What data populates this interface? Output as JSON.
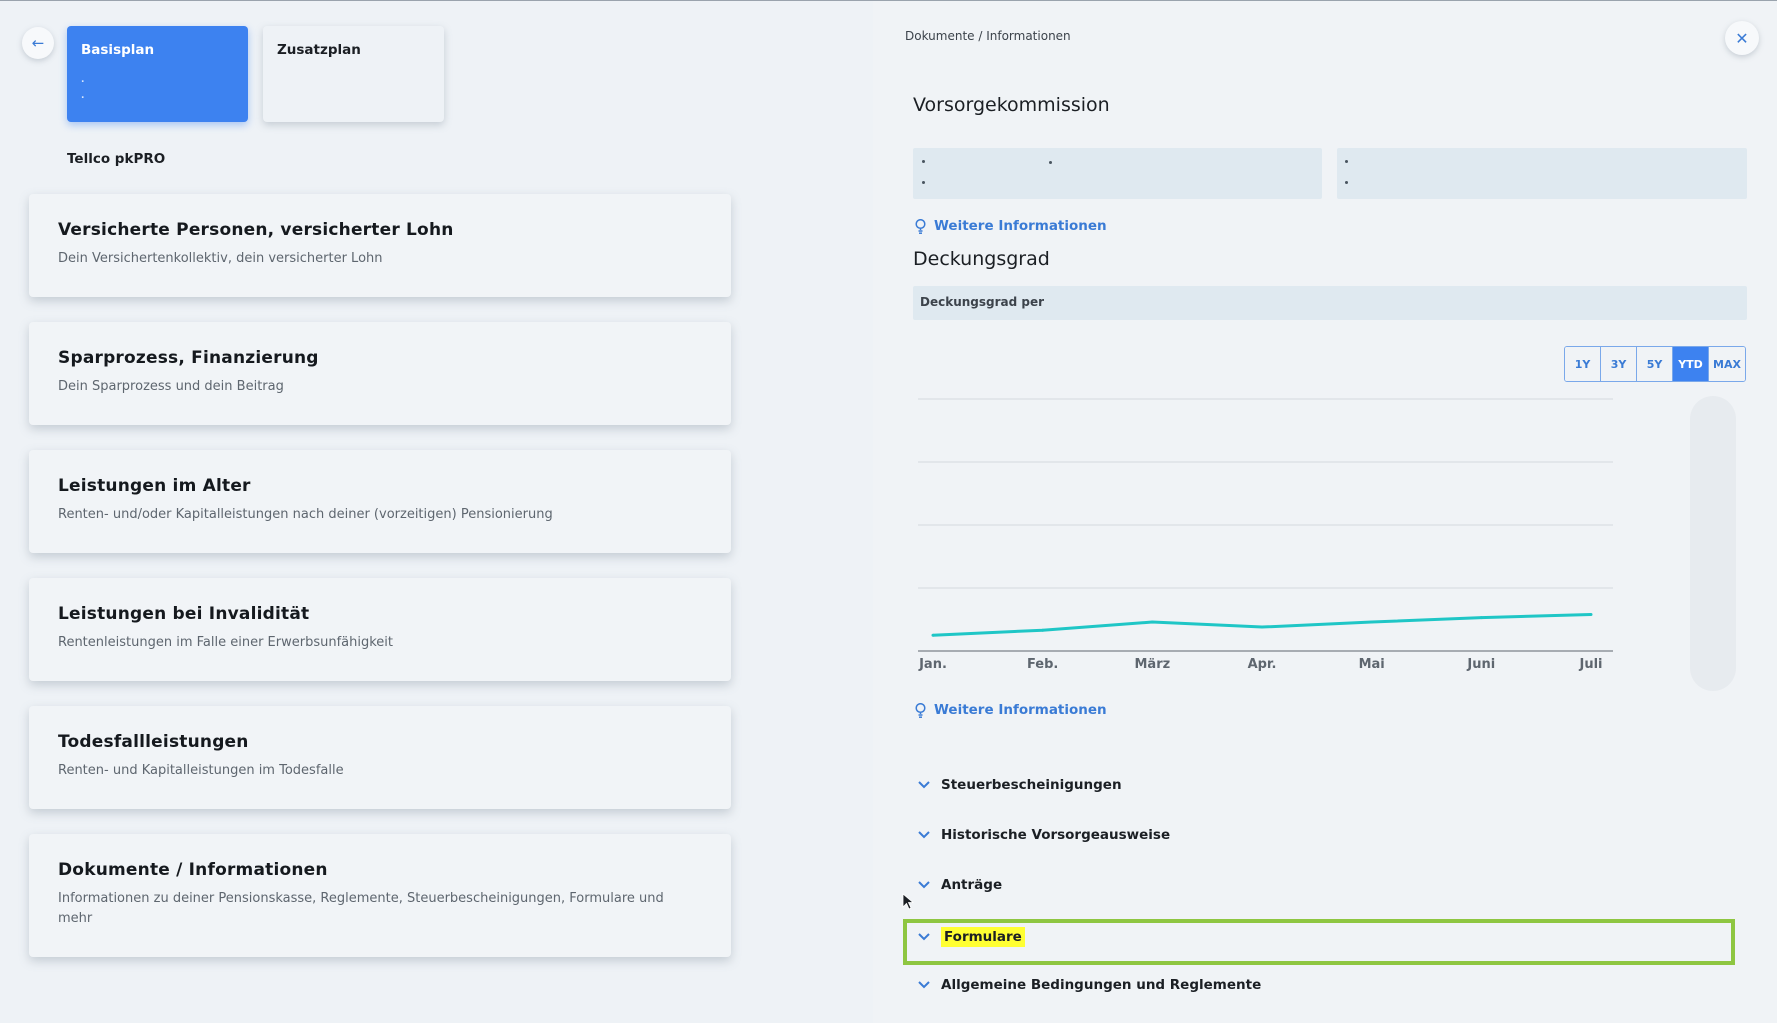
{
  "left": {
    "back_icon": "arrow-left-icon",
    "plans": [
      {
        "label": "Basisplan",
        "active": true
      },
      {
        "label": "Zusatzplan",
        "active": false
      }
    ],
    "provider": "Tellco pkPRO",
    "cards": [
      {
        "title": "Versicherte Personen, versicherter Lohn",
        "subtitle": "Dein Versichertenkollektiv, dein versicherter Lohn"
      },
      {
        "title": "Sparprozess, Finanzierung",
        "subtitle": "Dein Sparprozess und dein Beitrag"
      },
      {
        "title": "Leistungen im Alter",
        "subtitle": "Renten- und/oder Kapitalleistungen nach deiner (vorzeitigen) Pensionierung"
      },
      {
        "title": "Leistungen bei Invalidität",
        "subtitle": "Rentenleistungen im Falle einer Erwerbsunfähigkeit"
      },
      {
        "title": "Todesfallleistungen",
        "subtitle": "Renten- und Kapitalleistungen im Todesfalle"
      },
      {
        "title": "Dokumente / Informationen",
        "subtitle": "Informationen zu deiner Pensionskasse, Reglemente, Steuerbescheinigungen, Formulare und mehr"
      }
    ]
  },
  "right": {
    "breadcrumb": "Dokumente / Informationen",
    "close_icon": "close-icon",
    "vorsorge_title": "Vorsorgekommission",
    "more_info_label": "Weitere Informationen",
    "deckungsgrad_title": "Deckungsgrad",
    "deckungsgrad_per": "Deckungsgrad per",
    "ranges": [
      {
        "label": "1Y",
        "active": false
      },
      {
        "label": "3Y",
        "active": false
      },
      {
        "label": "5Y",
        "active": false
      },
      {
        "label": "YTD",
        "active": true
      },
      {
        "label": "MAX",
        "active": false
      }
    ],
    "accordion": [
      {
        "label": "Steuerbescheinigungen",
        "highlighted": false
      },
      {
        "label": "Historische Vorsorgeausweise",
        "highlighted": false
      },
      {
        "label": "Anträge",
        "highlighted": false
      },
      {
        "label": "Formulare",
        "highlighted": true
      },
      {
        "label": "Allgemeine Bedingungen und Reglemente",
        "highlighted": false
      }
    ]
  },
  "colors": {
    "accent": "#3d82f0",
    "line": "#1fc6c6",
    "highlight": "#ffff33",
    "focus_border": "#8ec641"
  },
  "chart_data": {
    "type": "line",
    "title": "",
    "xlabel": "",
    "ylabel": "",
    "categories": [
      "Jan.",
      "Feb.",
      "März",
      "Apr.",
      "Mai",
      "Juni",
      "Juli"
    ],
    "values": [
      0.25,
      0.33,
      0.46,
      0.38,
      0.46,
      0.53,
      0.58
    ],
    "ylim": [
      0,
      4
    ],
    "grid": true,
    "legend": "none"
  }
}
